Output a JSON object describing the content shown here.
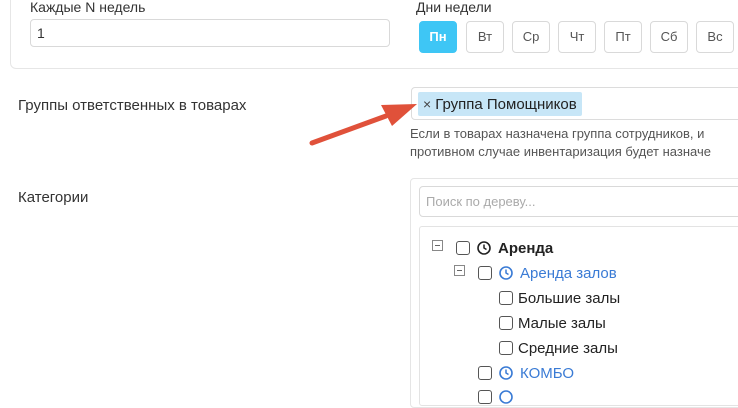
{
  "schedule": {
    "weeks_label": "Каждые N недель",
    "weeks_value": "1",
    "days_label": "Дни недели",
    "days": [
      {
        "label": "Пн",
        "active": true
      },
      {
        "label": "Вт",
        "active": false
      },
      {
        "label": "Ср",
        "active": false
      },
      {
        "label": "Чт",
        "active": false
      },
      {
        "label": "Пт",
        "active": false
      },
      {
        "label": "Сб",
        "active": false
      },
      {
        "label": "Вс",
        "active": false
      }
    ]
  },
  "groups": {
    "label": "Группы ответственных в товарах",
    "tag_remove": "×",
    "tag": "Группа Помощников",
    "help_line1": "Если в товарах назначена группа сотрудников, и",
    "help_line2": "противном случае инвентаризация будет назначе"
  },
  "categories": {
    "label": "Категории",
    "search_placeholder": "Поиск по дереву...",
    "tree": [
      {
        "label": "Аренда",
        "checked": false
      },
      {
        "label": "Аренда залов",
        "checked": false
      },
      {
        "label": "Большие залы",
        "checked": false
      },
      {
        "label": "Малые залы",
        "checked": false
      },
      {
        "label": "Средние залы",
        "checked": false
      },
      {
        "label": "КОМБО",
        "checked": false
      }
    ]
  },
  "colors": {
    "accent": "#3ec6f5",
    "tag_bg": "#c7e6f7",
    "link": "#3a7bd5",
    "arrow": "#e0513a"
  }
}
